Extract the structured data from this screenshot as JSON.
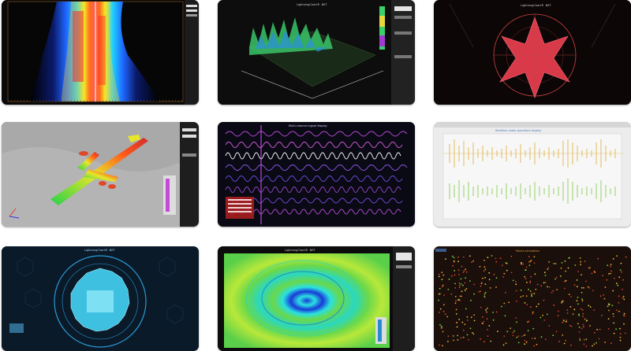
{
  "gallery": {
    "tiles": [
      {
        "id": "heatmap-spectrogram"
      },
      {
        "id": "surface-3d-green",
        "title": "LightningChart® .NET"
      },
      {
        "id": "polar-star",
        "title": "LightningChart® .NET"
      },
      {
        "id": "airplane-3d-model"
      },
      {
        "id": "multichannel-signals",
        "title": "Multi-channel signal display"
      },
      {
        "id": "audio-waveform",
        "title": "Realtime audio waveform display"
      },
      {
        "id": "polar-radar-cyan",
        "title": "LightningChart® .NET"
      },
      {
        "id": "intensity-grid-rings",
        "title": "LightningChart® .NET"
      },
      {
        "id": "scatter-points",
        "title": "Points simulation"
      }
    ]
  }
}
